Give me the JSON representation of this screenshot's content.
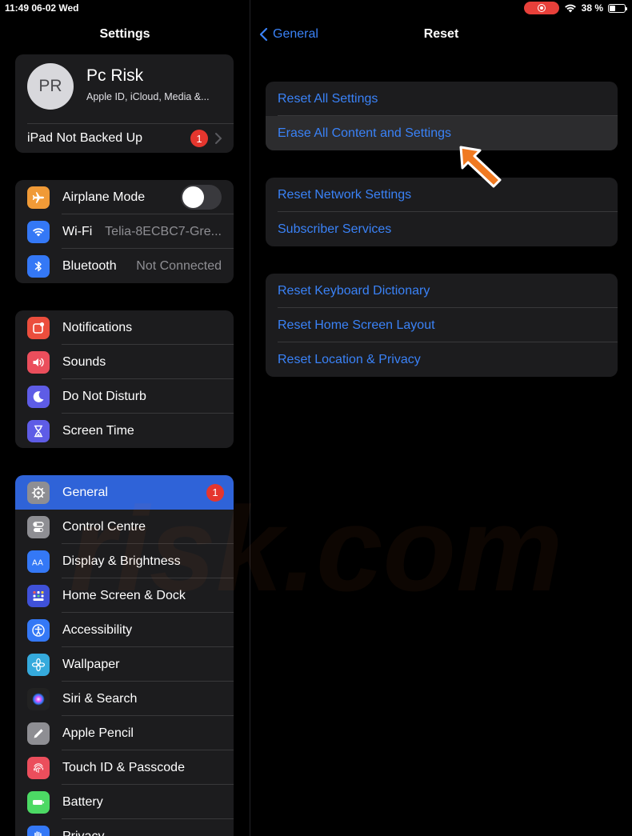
{
  "status_bar": {
    "time": "11:49  06-02 Wed",
    "battery": "38 %"
  },
  "sidebar": {
    "title": "Settings",
    "profile": {
      "initials": "PR",
      "name": "Pc Risk",
      "subtitle": "Apple ID, iCloud, Media &..."
    },
    "backup": {
      "label": "iPad Not Backed Up",
      "badge": "1"
    },
    "connectivity": [
      {
        "label": "Airplane Mode",
        "icon": "airplane-icon",
        "color": "#f09a37"
      },
      {
        "label": "Wi-Fi",
        "value": "Telia-8ECBC7-Gre...",
        "icon": "wifi-icon",
        "color": "#3478f6"
      },
      {
        "label": "Bluetooth",
        "value": "Not Connected",
        "icon": "bluetooth-icon",
        "color": "#3478f6"
      }
    ],
    "alerts": [
      {
        "label": "Notifications",
        "icon": "notifications-icon",
        "color": "#eb4e3d"
      },
      {
        "label": "Sounds",
        "icon": "sounds-icon",
        "color": "#eb4e5c"
      },
      {
        "label": "Do Not Disturb",
        "icon": "moon-icon",
        "color": "#5e5ce6"
      },
      {
        "label": "Screen Time",
        "icon": "hourglass-icon",
        "color": "#5e5ce6"
      }
    ],
    "general_items": [
      {
        "label": "General",
        "badge": "1",
        "icon": "gear-icon",
        "color": "#8e8e93"
      },
      {
        "label": "Control Centre",
        "icon": "toggles-icon",
        "color": "#8e8e93"
      },
      {
        "label": "Display & Brightness",
        "icon": "text-size-icon",
        "color": "#3478f6"
      },
      {
        "label": "Home Screen & Dock",
        "icon": "home-grid-icon",
        "color": "#3f51d8"
      },
      {
        "label": "Accessibility",
        "icon": "accessibility-icon",
        "color": "#3478f6"
      },
      {
        "label": "Wallpaper",
        "icon": "flower-icon",
        "color": "#35aadc"
      },
      {
        "label": "Siri & Search",
        "icon": "siri-icon",
        "color": "#222"
      },
      {
        "label": "Apple Pencil",
        "icon": "pencil-icon",
        "color": "#8e8e93"
      },
      {
        "label": "Touch ID & Passcode",
        "icon": "fingerprint-icon",
        "color": "#eb4e5c"
      },
      {
        "label": "Battery",
        "icon": "battery-icon",
        "color": "#4cd964"
      },
      {
        "label": "Privacy",
        "icon": "hand-icon",
        "color": "#3478f6"
      }
    ]
  },
  "detail": {
    "back_label": "General",
    "title": "Reset",
    "groups": [
      [
        "Reset All Settings",
        "Erase All Content and Settings"
      ],
      [
        "Reset Network Settings",
        "Subscriber Services"
      ],
      [
        "Reset Keyboard Dictionary",
        "Reset Home Screen Layout",
        "Reset Location & Privacy"
      ]
    ]
  },
  "accent_color": "#3a82f7",
  "selection_color": "#2f63d8",
  "watermark": "risk.com"
}
